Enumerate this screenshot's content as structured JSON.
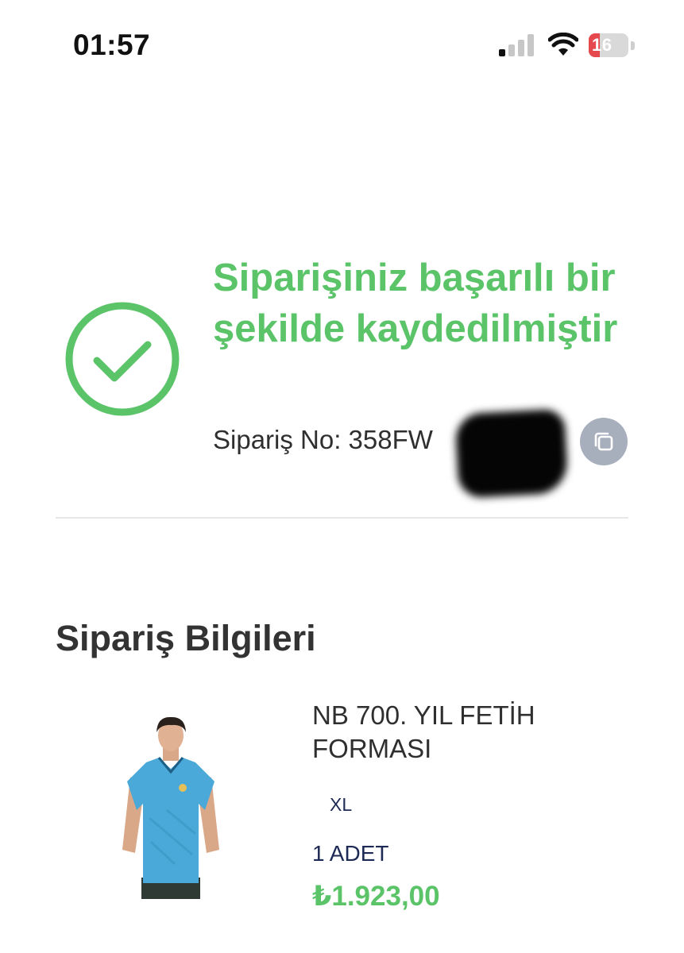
{
  "status_bar": {
    "time": "01:57",
    "battery_text": "16",
    "battery_level": 0.16
  },
  "confirmation": {
    "title": "Siparişiniz başarılı bir şekilde kaydedilmiştir",
    "order_number": "Sipariş No: 358FW",
    "copy_icon": "copy-icon",
    "success_icon": "check-circle-icon"
  },
  "order_info": {
    "section_title": "Sipariş Bilgileri",
    "product": {
      "name": "NB 700. YIL FETİH FORMASI",
      "size": "XL",
      "quantity": "1 ADET",
      "price": "₺1.923,00"
    }
  },
  "colors": {
    "success_green": "#5bc469",
    "navy_text": "#1d2a55",
    "copy_button_bg": "#a7afbd",
    "battery_low": "#e5484d",
    "jersey_blue": "#4aa9d8"
  }
}
